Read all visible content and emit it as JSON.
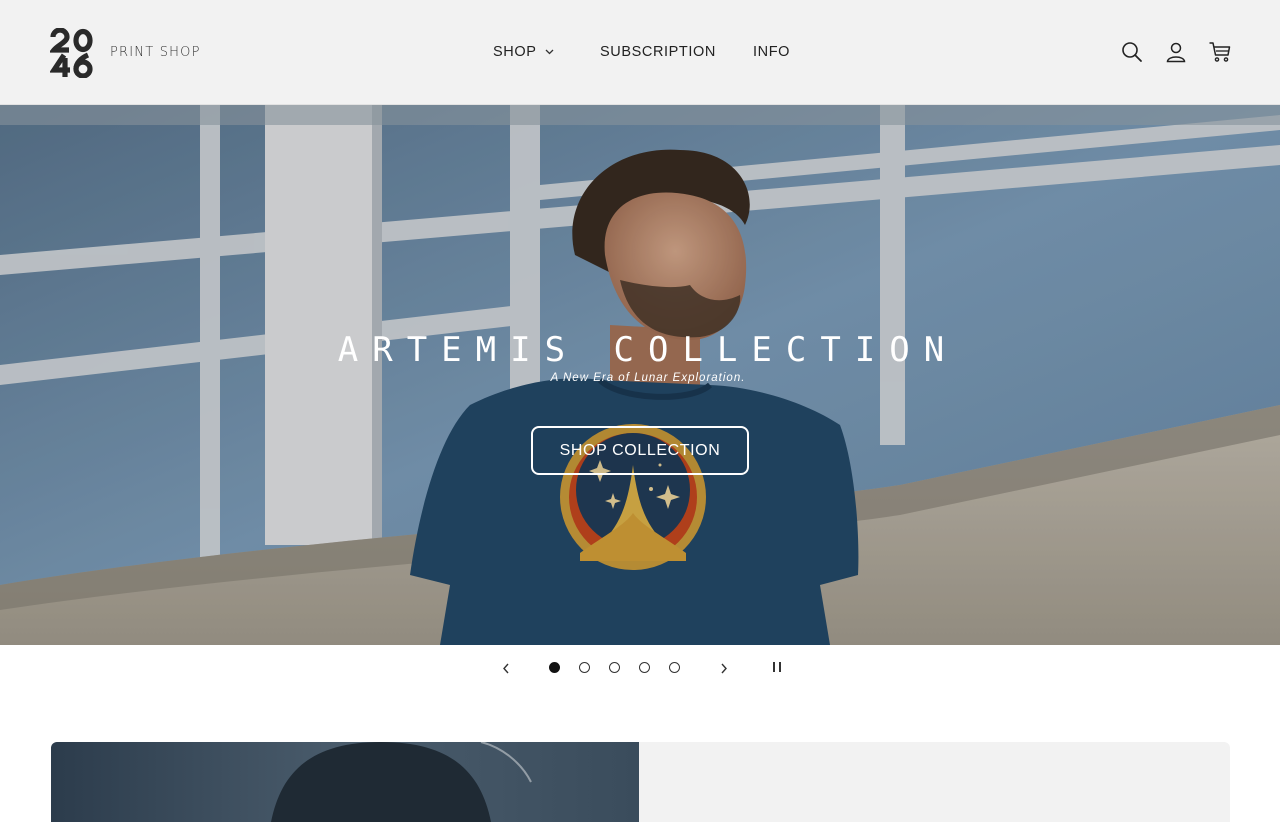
{
  "brand": {
    "logo_text": "PRINT SHOP",
    "logo_mark": "20 46"
  },
  "nav": [
    {
      "label": "SHOP",
      "has_dropdown": true
    },
    {
      "label": "SUBSCRIPTION"
    },
    {
      "label": "INFO"
    }
  ],
  "header_icons": [
    "search-icon",
    "account-icon",
    "cart-icon"
  ],
  "hero": {
    "title": "ARTEMIS COLLECTION",
    "subtitle": "A New Era of Lunar Exploration.",
    "button_label": "SHOP COLLECTION"
  },
  "slider": {
    "slides": 5,
    "active_slide": 1,
    "icons": [
      "chevron-left-icon",
      "chevron-right-icon",
      "pause-icon"
    ]
  },
  "colors": {
    "header_bg": "#f2f2f2",
    "text": "#222222",
    "hero_text": "#ffffff",
    "active_dot": "#121212"
  }
}
